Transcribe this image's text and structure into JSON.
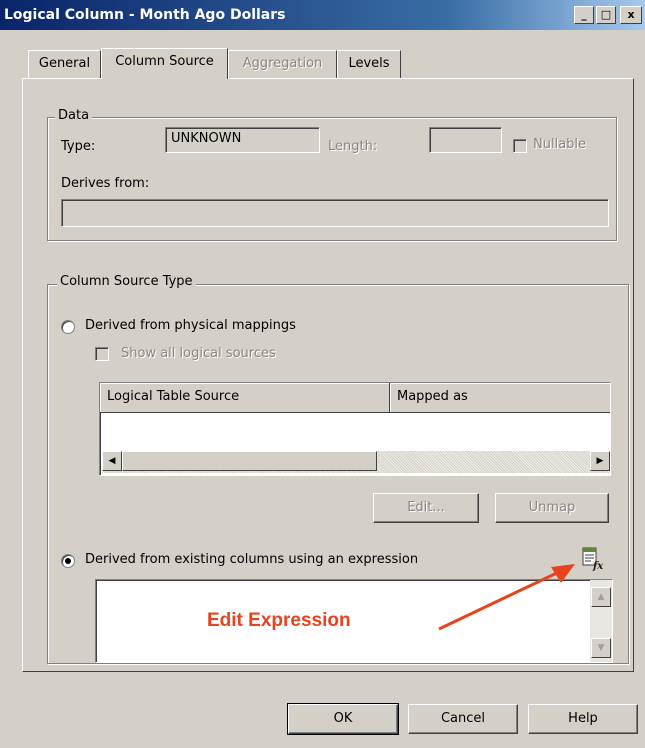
{
  "window": {
    "title": "Logical Column - Month Ago Dollars",
    "controls": [
      "_",
      "□",
      "x"
    ]
  },
  "tabs": [
    {
      "label": "General",
      "state": "normal"
    },
    {
      "label": "Column Source",
      "state": "active"
    },
    {
      "label": "Aggregation",
      "state": "disabled"
    },
    {
      "label": "Levels",
      "state": "normal"
    }
  ],
  "data_group": {
    "title": "Data",
    "type_label": "Type:",
    "type_value": "UNKNOWN",
    "length_label": "Length:",
    "length_value": "",
    "nullable_label": "Nullable",
    "nullable_checked": false,
    "derives_label": "Derives from:",
    "derives_value": ""
  },
  "source_group": {
    "title": "Column Source Type",
    "option_physical_label": "Derived from physical mappings",
    "option_physical_selected": false,
    "show_all_label": "Show all logical sources",
    "show_all_checked": false,
    "grid_columns": [
      "Logical Table Source",
      "Mapped as"
    ],
    "grid_rows": [],
    "edit_label": "Edit...",
    "unmap_label": "Unmap",
    "option_expression_label": "Derived from existing columns using an expression",
    "option_expression_selected": true,
    "expression_value": ""
  },
  "annotation": {
    "text": "Edit Expression",
    "color": "#e8431f"
  },
  "footer": {
    "ok_label": "OK",
    "cancel_label": "Cancel",
    "help_label": "Help"
  },
  "icons": {
    "expression_builder": "edit-expression-icon",
    "scroll_left": "◀",
    "scroll_right": "▶",
    "scroll_up": "▲",
    "scroll_down": "▼"
  }
}
